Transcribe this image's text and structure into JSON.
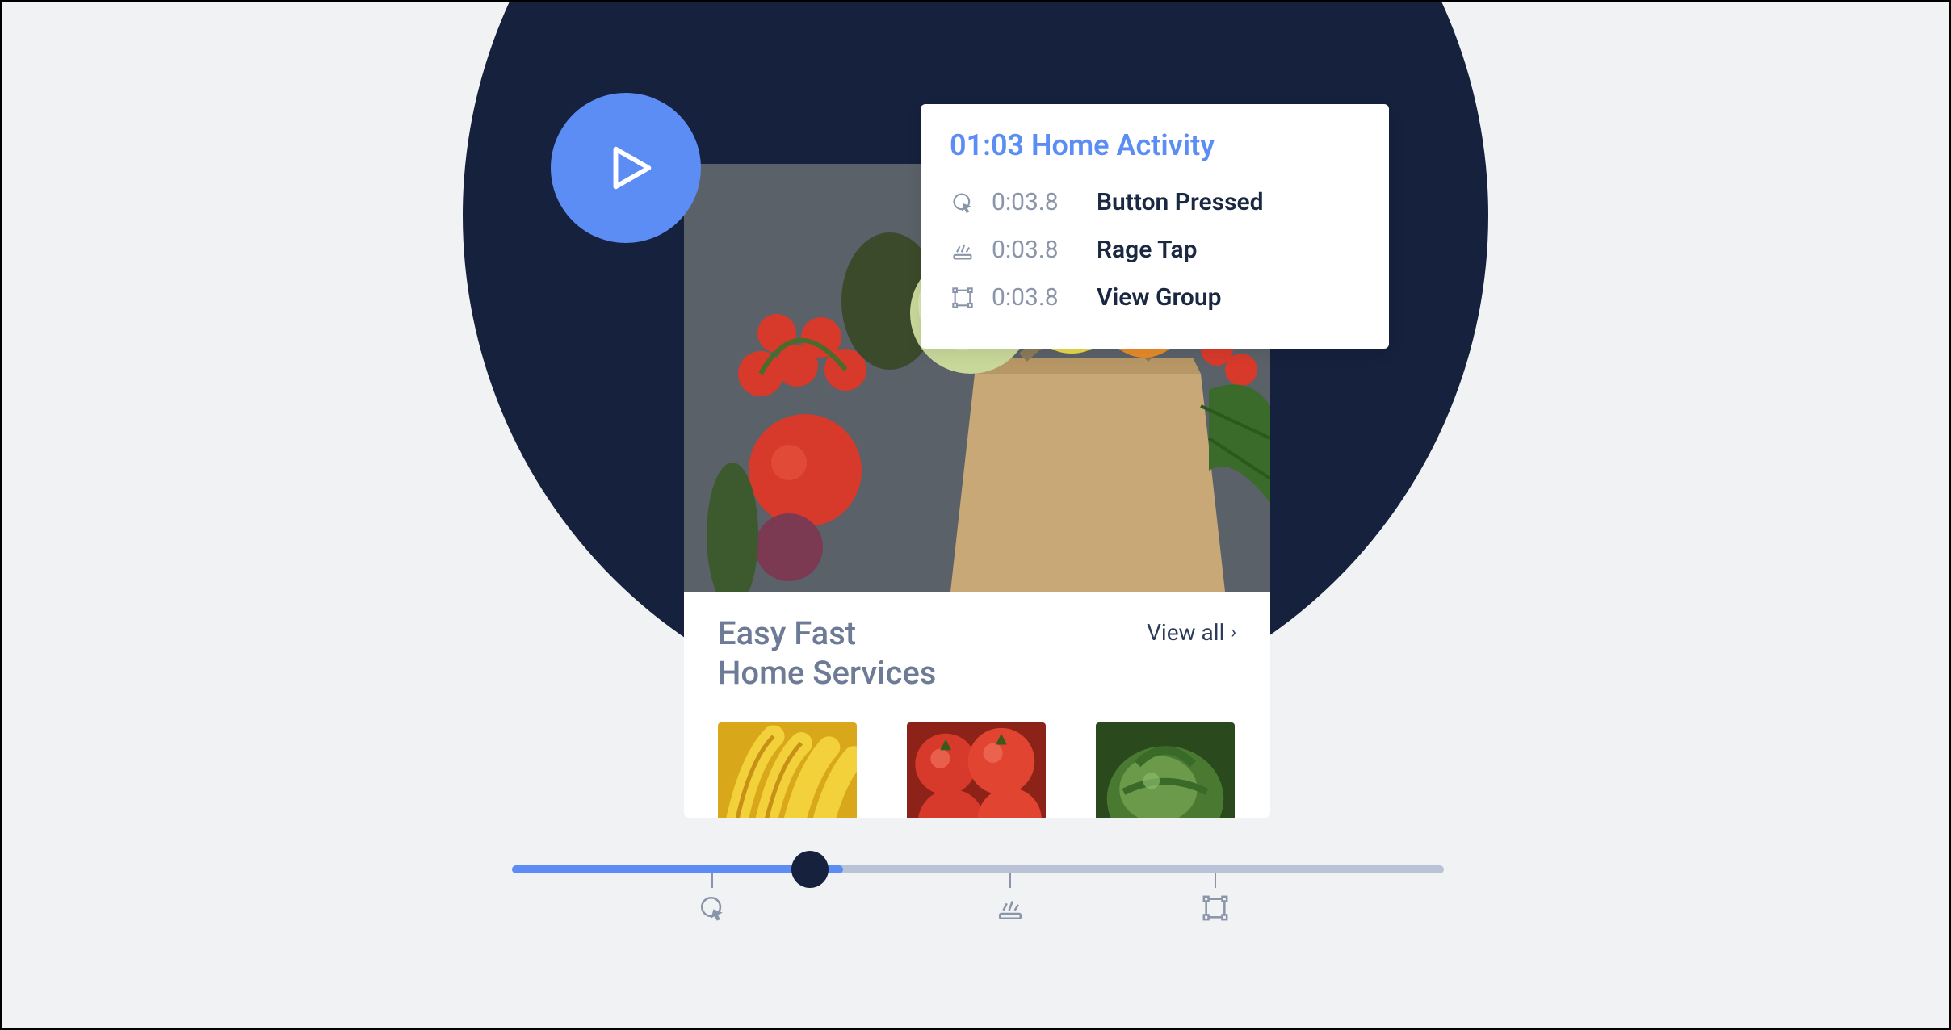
{
  "events_panel": {
    "title": "01:03 Home Activity",
    "rows": [
      {
        "icon": "cursor-click-icon",
        "time": "0:03.8",
        "label": "Button Pressed"
      },
      {
        "icon": "rage-tap-icon",
        "time": "0:03.8",
        "label": "Rage Tap"
      },
      {
        "icon": "view-group-icon",
        "time": "0:03.8",
        "label": "View Group"
      }
    ]
  },
  "phone_card": {
    "title_line1": "Easy Fast",
    "title_line2": "Home Services",
    "view_all_label": "View all",
    "thumbs": [
      "bananas",
      "tomatoes",
      "greens"
    ]
  },
  "timeline": {
    "progress_pct": 35.5,
    "markers": [
      {
        "icon": "cursor-click-icon",
        "pos_pct": 20
      },
      {
        "icon": "rage-tap-icon",
        "pos_pct": 52
      },
      {
        "icon": "view-group-icon",
        "pos_pct": 74
      }
    ]
  },
  "colors": {
    "accent": "#5b8df5",
    "dark": "#15213d",
    "muted": "#8a95aa"
  }
}
